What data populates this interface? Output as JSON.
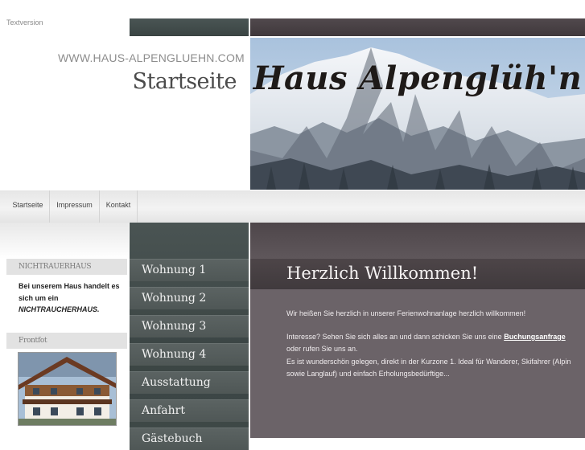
{
  "header": {
    "textversion": "Textversion",
    "site_url": "WWW.HAUS-ALPENGLUEHN.COM",
    "page_title": "Startseite",
    "banner_title": "Haus Alpenglüh'n"
  },
  "nav": {
    "items": [
      {
        "label": "Startseite"
      },
      {
        "label": "Impressum"
      },
      {
        "label": "Kontakt"
      }
    ]
  },
  "menu": {
    "items": [
      {
        "label": "Wohnung 1"
      },
      {
        "label": "Wohnung 2"
      },
      {
        "label": "Wohnung 3"
      },
      {
        "label": "Wohnung 4"
      },
      {
        "label": "Ausstattung"
      },
      {
        "label": "Anfahrt"
      },
      {
        "label": "Gästebuch"
      }
    ]
  },
  "sidebar": {
    "nonsmoking_heading": "NICHTRAUERHAUS",
    "nonsmoking_text_1": "Bei unserem Haus handelt es sich um ein",
    "nonsmoking_text_2": "NICHTRAUCHERHAUS.",
    "photo_heading": "Frontfot"
  },
  "content": {
    "welcome_title": "Herzlich Willkommen!",
    "intro": "Wir heißen Sie herzlich in unserer Ferienwohnanlage herzlich willkommen!",
    "interest_prefix": "Interesse? Sehen Sie sich alles an und dann schicken Sie uns eine",
    "booking_link": "Buchungsanfrage",
    "interest_suffix": "oder rufen Sie uns an.",
    "location": "Es ist wunderschön gelegen, direkt in der Kurzone 1. Ideal für Wanderer, Skifahrer (Alpin sowie Langlauf) und einfach Erholungsbedürftige..."
  },
  "colors": {
    "menu_bg": "#3e4847",
    "content_bg": "#6b6368",
    "welcome_bar": "#443d40"
  }
}
